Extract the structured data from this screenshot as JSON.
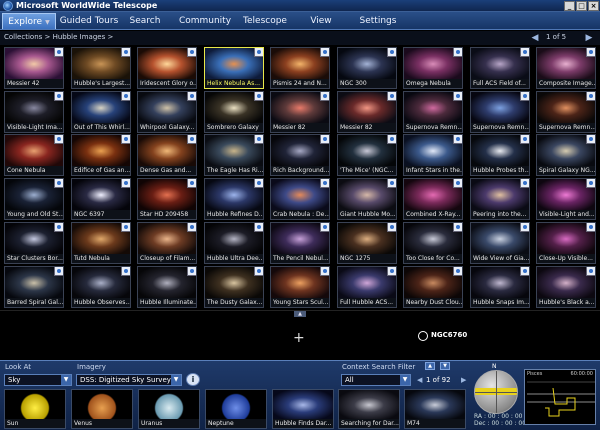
{
  "window": {
    "title": "Microsoft WorldWide Telescope",
    "controls": [
      "_",
      "□",
      "×"
    ]
  },
  "menu": {
    "tabs": [
      {
        "label": "Explore",
        "active": true
      },
      {
        "label": "Guided Tours"
      },
      {
        "label": "Search"
      },
      {
        "label": "Community"
      },
      {
        "label": "Telescope"
      },
      {
        "label": "View"
      },
      {
        "label": "Settings"
      }
    ]
  },
  "breadcrumb": "Collections  >  Hubble Images  >",
  "pager_top": {
    "text": "1 of 5"
  },
  "thumbnails": [
    {
      "caption": "Messier 42",
      "colors": [
        "#2b1035",
        "#a8588f",
        "#f1c9a7"
      ]
    },
    {
      "caption": "Hubble's Largest...",
      "colors": [
        "#1a1208",
        "#6e4a24",
        "#c89456"
      ]
    },
    {
      "caption": "Iridescent Glory o...",
      "colors": [
        "#1b0b05",
        "#b6522e",
        "#ffd89a"
      ]
    },
    {
      "caption": "Helix Nebula As...",
      "colors": [
        "#0e1b3a",
        "#3a6fb8",
        "#e59050"
      ],
      "selected": true
    },
    {
      "caption": "Pismis 24 and N...",
      "colors": [
        "#1a0c08",
        "#8c4020",
        "#f3b46a"
      ]
    },
    {
      "caption": "NGC 300",
      "colors": [
        "#050810",
        "#2c3452",
        "#a4b3d6"
      ]
    },
    {
      "caption": "Omega Nebula",
      "colors": [
        "#1a0a1c",
        "#7a3063",
        "#d98cb8"
      ]
    },
    {
      "caption": "Full ACS Field of...",
      "colors": [
        "#0a0c16",
        "#36304e",
        "#b8a6c8"
      ]
    },
    {
      "caption": "Composite Image...",
      "colors": [
        "#1a0c18",
        "#7d3c6a",
        "#e8b0d0"
      ]
    },
    {
      "caption": "Visible-Light Ima...",
      "colors": [
        "#050505",
        "#1e1e28",
        "#8888a0"
      ]
    },
    {
      "caption": "Out of This Whirl...",
      "colors": [
        "#050816",
        "#27427a",
        "#d7d3c4"
      ]
    },
    {
      "caption": "Whirpool Galaxy...",
      "colors": [
        "#080a10",
        "#34405c",
        "#cfc2a8"
      ]
    },
    {
      "caption": "Sombrero Galaxy",
      "colors": [
        "#060606",
        "#3a3326",
        "#eae0c2"
      ]
    },
    {
      "caption": "Messier 82",
      "colors": [
        "#0a0a12",
        "#5e3a3a",
        "#e87a6a"
      ]
    },
    {
      "caption": "Messier 82",
      "colors": [
        "#0c0c14",
        "#6a2a2a",
        "#f29684"
      ]
    },
    {
      "caption": "Supernova Remn...",
      "colors": [
        "#080810",
        "#4c2a3c",
        "#d06aa0"
      ]
    },
    {
      "caption": "Supernova Remn...",
      "colors": [
        "#060610",
        "#2e3c6c",
        "#7ca0e0"
      ]
    },
    {
      "caption": "Supernova Remn...",
      "colors": [
        "#0a0808",
        "#4c2418",
        "#e09060"
      ]
    },
    {
      "caption": "Cone Nebula",
      "colors": [
        "#200808",
        "#8a2620",
        "#e8a070"
      ]
    },
    {
      "caption": "Edifice of Gas an...",
      "colors": [
        "#140604",
        "#7a3010",
        "#eaa050"
      ]
    },
    {
      "caption": "Dense Gas and...",
      "colors": [
        "#180a06",
        "#84421e",
        "#f0b878"
      ]
    },
    {
      "caption": "The Eagle Has Ri...",
      "colors": [
        "#0a0c12",
        "#3a4a5c",
        "#c8b48a"
      ]
    },
    {
      "caption": "Rich Background...",
      "colors": [
        "#06060a",
        "#202438",
        "#a6a8c4"
      ]
    },
    {
      "caption": "'The Mice' (NGC...",
      "colors": [
        "#040608",
        "#22303e",
        "#c8c8d6"
      ]
    },
    {
      "caption": "Infant Stars in the...",
      "colors": [
        "#0a1020",
        "#3c5a8c",
        "#e0e8f8"
      ]
    },
    {
      "caption": "Hubble Probes th...",
      "colors": [
        "#06080c",
        "#24304a",
        "#e8eaf0"
      ]
    },
    {
      "caption": "Spiral Galaxy NG...",
      "colors": [
        "#080a10",
        "#3a4660",
        "#d6cbb0"
      ]
    },
    {
      "caption": "Young and Old St...",
      "colors": [
        "#04060a",
        "#1a2236",
        "#9cafd0"
      ]
    },
    {
      "caption": "NGC 6397",
      "colors": [
        "#04040a",
        "#2a2a44",
        "#f0f0ff"
      ]
    },
    {
      "caption": "Star HD 209458",
      "colors": [
        "#100404",
        "#6a1e14",
        "#e47050"
      ]
    },
    {
      "caption": "Hubble Refines D...",
      "colors": [
        "#060812",
        "#2c3868",
        "#9cb4ec"
      ]
    },
    {
      "caption": "Crab Nebula : De...",
      "colors": [
        "#0a0a1a",
        "#3e4a88",
        "#e48a5a"
      ]
    },
    {
      "caption": "Giant Hubble Mo...",
      "colors": [
        "#0c0c12",
        "#584a6a",
        "#d6b8a8"
      ]
    },
    {
      "caption": "Combined X-Ray...",
      "colors": [
        "#14060e",
        "#7a2a5a",
        "#e46ab2"
      ]
    },
    {
      "caption": "Peering into the...",
      "colors": [
        "#0a0a14",
        "#4c3a6c",
        "#e0c0a0"
      ]
    },
    {
      "caption": "Visible-Light and...",
      "colors": [
        "#0e0610",
        "#6a2464",
        "#ee7ad4"
      ]
    },
    {
      "caption": "Star Clusters Bor...",
      "colors": [
        "#040408",
        "#1c2030",
        "#c4c8e0"
      ]
    },
    {
      "caption": "Tutd Nebula",
      "colors": [
        "#140a06",
        "#6c3a1c",
        "#e0a86a"
      ]
    },
    {
      "caption": "Closeup of Filam...",
      "colors": [
        "#120a08",
        "#6e3c24",
        "#eab48a"
      ]
    },
    {
      "caption": "Hubble Ultra Dee...",
      "colors": [
        "#040406",
        "#1c1c26",
        "#b4b4c4"
      ]
    },
    {
      "caption": "The Pencil Nebul...",
      "colors": [
        "#0c0812",
        "#3e2c5a",
        "#c6a0d8"
      ]
    },
    {
      "caption": "NGC 1275",
      "colors": [
        "#0a0806",
        "#4a3020",
        "#dcae80"
      ]
    },
    {
      "caption": "Too Close for Co...",
      "colors": [
        "#06060a",
        "#2a2c3c",
        "#c8cad8"
      ]
    },
    {
      "caption": "Wide View of Gia...",
      "colors": [
        "#0a0c14",
        "#3a4a6a",
        "#c8d0e0"
      ]
    },
    {
      "caption": "Close-Up Visible...",
      "colors": [
        "#0e060c",
        "#54204a",
        "#d86ac2"
      ]
    },
    {
      "caption": "Barred Spiral Gal...",
      "colors": [
        "#06080e",
        "#2c3648",
        "#cac0a8"
      ]
    },
    {
      "caption": "Hubble Observes...",
      "colors": [
        "#06060a",
        "#262a3c",
        "#aab0c8"
      ]
    },
    {
      "caption": "Hubble Illuminate...",
      "colors": [
        "#060608",
        "#24242e",
        "#b0b0be"
      ]
    },
    {
      "caption": "The Dusty Galax...",
      "colors": [
        "#0a0806",
        "#3e3020",
        "#d8c4a0"
      ]
    },
    {
      "caption": "Young Stars Scul...",
      "colors": [
        "#14080a",
        "#6e3420",
        "#eca060"
      ]
    },
    {
      "caption": "Full Hubble ACS...",
      "colors": [
        "#0a0a16",
        "#3a3a6c",
        "#d0a6d8"
      ]
    },
    {
      "caption": "Nearby Dust Clou...",
      "colors": [
        "#0c0606",
        "#4c2418",
        "#c88a60"
      ]
    },
    {
      "caption": "Hubble Snaps Im...",
      "colors": [
        "#06060c",
        "#2a2a40",
        "#c0b8d0"
      ]
    },
    {
      "caption": "Hubble's Black a...",
      "colors": [
        "#0c0810",
        "#3a2a4c",
        "#d4b0c8"
      ]
    }
  ],
  "view": {
    "target_label": "NGC6760",
    "crosshair": "+"
  },
  "bottom": {
    "look_at_label": "Look At",
    "look_at_value": "Sky",
    "imagery_label": "Imagery",
    "imagery_value": "DSS: Digitized Sky Survey (...",
    "context_label": "Context Search Filter",
    "context_value": "All",
    "context_pager": "1 of 92",
    "planets": [
      {
        "caption": "Sun",
        "colors": [
          "#000",
          "#b8a000",
          "#ffee44"
        ]
      },
      {
        "caption": "Venus",
        "colors": [
          "#000",
          "#a0521c",
          "#e8a050"
        ]
      },
      {
        "caption": "Uranus",
        "colors": [
          "#000",
          "#6a9ab0",
          "#d8eaf0"
        ]
      },
      {
        "caption": "Neptune",
        "colors": [
          "#000",
          "#1e3c9a",
          "#6e8ee8"
        ]
      }
    ],
    "context_items": [
      {
        "caption": "Hubble Finds Dar...",
        "colors": [
          "#06081a",
          "#2a3c7a",
          "#a8b8e8"
        ]
      },
      {
        "caption": "Searching for Dar...",
        "colors": [
          "#0a0a10",
          "#3c3c48",
          "#c8c8d0"
        ]
      },
      {
        "caption": "M74",
        "colors": [
          "#06080e",
          "#2a3858",
          "#c8ccd8"
        ]
      }
    ],
    "north_label": "N",
    "ra_label": "RA :",
    "ra_value": "00 : 00 : 00",
    "dec_label": "Dec :",
    "dec_value": "00 : 00 : 00",
    "constellation_label": "Pisces",
    "constellation_value": "60:00:00"
  }
}
